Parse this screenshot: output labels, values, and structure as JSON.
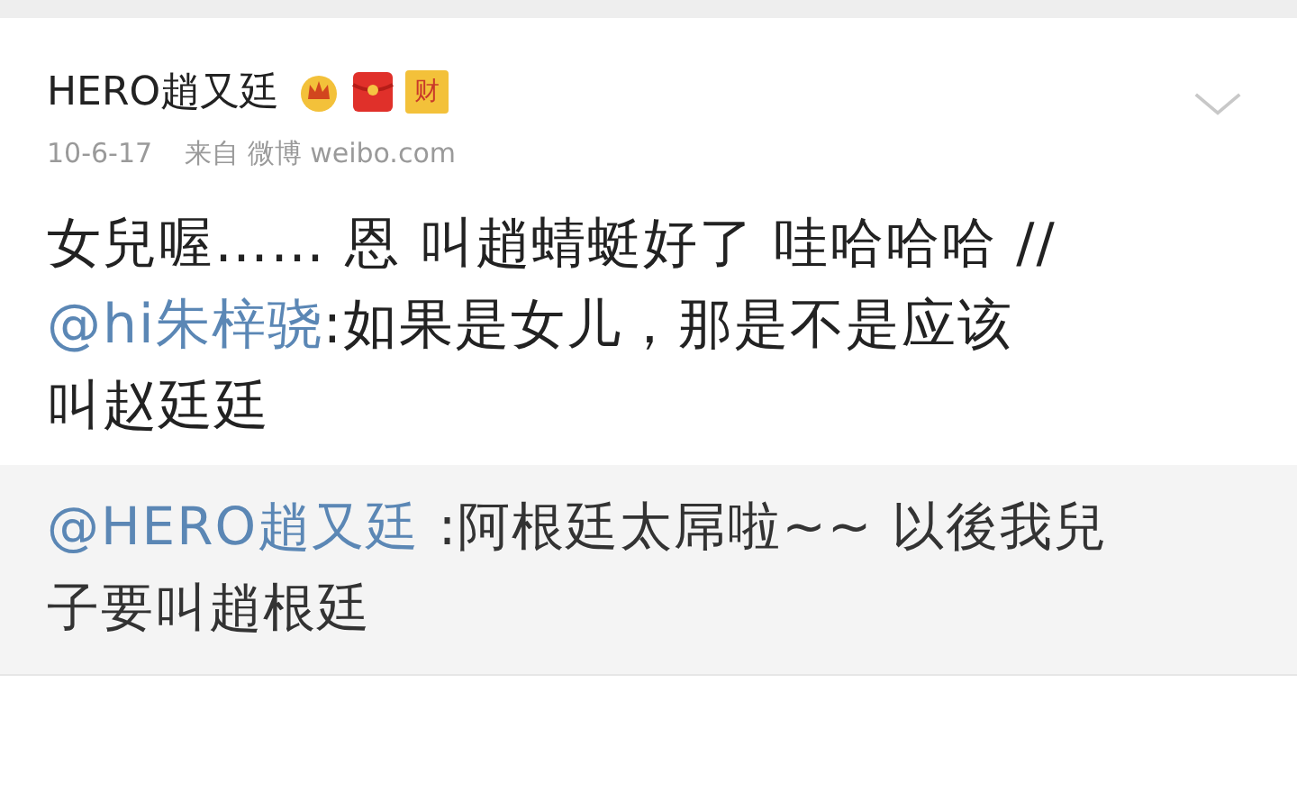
{
  "post": {
    "author": "HERO趙又廷",
    "badges": [
      {
        "kind": "crown"
      },
      {
        "kind": "red-packet"
      },
      {
        "kind": "label",
        "text": "财"
      }
    ],
    "date": "10-6-17",
    "source": "来自 微博 weibo.com",
    "lines": [
      [
        {
          "kind": "text",
          "text": "女兒喔…… 恩 叫趙蜻蜓好了 哇哈哈哈 //"
        }
      ],
      [
        {
          "kind": "mention",
          "text": "@hi朱梓骁"
        },
        {
          "kind": "text",
          "text": ":如果是女儿，那是不是应该"
        }
      ],
      [
        {
          "kind": "text",
          "text": "叫赵廷廷"
        }
      ]
    ]
  },
  "repost": {
    "lines": [
      [
        {
          "kind": "mention",
          "text": "@HERO趙又廷"
        },
        {
          "kind": "text",
          "text": " :阿根廷太屌啦~~ 以後我兒"
        }
      ],
      [
        {
          "kind": "text",
          "text": "子要叫趙根廷"
        }
      ]
    ]
  }
}
